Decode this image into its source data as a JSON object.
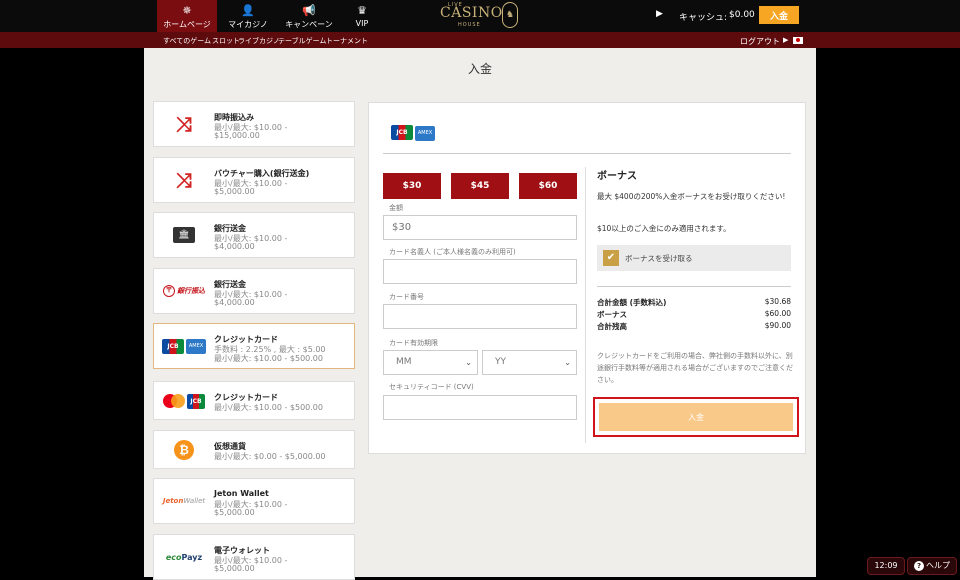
{
  "nav": {
    "items": [
      {
        "label": "ホームページ",
        "icon": "chip-icon"
      },
      {
        "label": "マイカジノ",
        "icon": "user-icon"
      },
      {
        "label": "キャンペーン",
        "icon": "megaphone-icon"
      },
      {
        "label": "VIP",
        "icon": "crown-icon"
      }
    ],
    "logo": {
      "live": "LIVE",
      "casino": "CASINO",
      "house": "HOUSE"
    },
    "cash_label": "キャッシュ:",
    "cash_value": "$0.00",
    "deposit_label": "入金"
  },
  "subnav": {
    "links": [
      "すべてのゲーム",
      "スロット",
      "ライブカジノ",
      "テーブルゲーム",
      "トーナメント"
    ],
    "logout": "ログアウト"
  },
  "page": {
    "title": "入金"
  },
  "methods": [
    {
      "icon": "shuffle-icon",
      "title": "即時振込み",
      "line1": "最小/最大: $10.00 -",
      "line2": "$15,000.00"
    },
    {
      "icon": "shuffle-icon",
      "title": "バウチャー購入(銀行送金)",
      "line1": "最小/最大: $10.00 -",
      "line2": "$5,000.00"
    },
    {
      "icon": "monitor-bank-icon",
      "title": "銀行送金",
      "line1": "最小/最大: $10.00 -",
      "line2": "$4,000.00"
    },
    {
      "icon": "bank-transfer-logo",
      "title": "銀行送金",
      "line1": "最小/最大: $10.00 -",
      "line2": "$4,000.00"
    },
    {
      "icon": "jcb-amex-icon",
      "title": "クレジットカード",
      "line1": "手数料 : 2.25% , 最大 : $5.00",
      "line2": "最小/最大: $10.00 - $500.00"
    },
    {
      "icon": "mastercard-jcb-icon",
      "title": "クレジットカード",
      "line1": "最小/最大: $10.00 - $500.00",
      "line2": ""
    },
    {
      "icon": "bitcoin-icon",
      "title": "仮想通貨",
      "line1": "最小/最大: $0.00 - $5,000.00",
      "line2": ""
    },
    {
      "icon": "jeton-logo",
      "title": "Jeton Wallet",
      "line1": "最小/最大: $10.00 -",
      "line2": "$5,000.00"
    },
    {
      "icon": "ecopayz-logo",
      "title": "電子ウォレット",
      "line1": "最小/最大: $10.00 -",
      "line2": "$5,000.00"
    }
  ],
  "logos": {
    "bank_text": "銀行振込",
    "jeton_a": "Jeton",
    "jeton_b": "Wallet",
    "eco_a": "eco",
    "eco_b": "Payz"
  },
  "form": {
    "amount_buttons": [
      "$30",
      "$45",
      "$60"
    ],
    "amount_label": "金額",
    "amount_placeholder": "$30",
    "holder_label": "カード名義人 (ご本人様名義のみ利用可)",
    "card_number_label": "カード番号",
    "expiry_label": "カード有効期限",
    "month_value": "MM",
    "year_value": "YY",
    "cvv_label": "セキュリティコード (CVV)",
    "submit_label": "入金"
  },
  "bonus": {
    "title": "ボーナス",
    "text": "最大 $400の200%入金ボーナスをお受け取りください!",
    "min_text": "$10以上のご入金にのみ適用されます。",
    "checkbox_label": "ボーナスを受け取る",
    "checked": true
  },
  "summary": {
    "rows": [
      {
        "label": "合計金額 (手数料込)",
        "value": "$30.68"
      },
      {
        "label": "ボーナス",
        "value": "$60.00"
      },
      {
        "label": "合計残高",
        "value": "$90.00"
      }
    ],
    "note": "クレジットカードをご利用の場合、弊社側の手数料以外に、別途銀行手数料等が適用される場合がございますのでご注意ください。"
  },
  "footer": {
    "clock": "12:09",
    "help_label": "ヘルプ"
  },
  "colors": {
    "brand_red": "#a00f13",
    "accent_orange": "#f6a623",
    "submit_disabled": "#f9c98a",
    "gold": "#c9a045"
  }
}
